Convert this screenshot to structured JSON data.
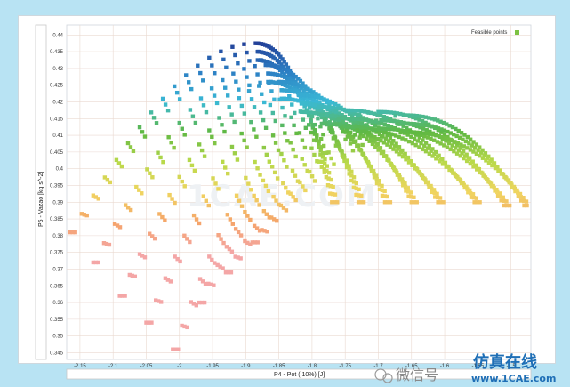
{
  "chart_data": {
    "type": "scatter",
    "title": "",
    "xlabel": "P4 - Pot (.10%) [J]",
    "ylabel": "P5 - Vazao  [kg s^-2]",
    "xlim": [
      -2.17,
      -1.47
    ],
    "ylim": [
      0.343,
      0.443
    ],
    "x_ticks": [
      "-2.15",
      "-2.1",
      "-2.05",
      "-2",
      "-1.95",
      "-1.9",
      "-1.85",
      "-1.8",
      "-1.75",
      "-1.7",
      "-1.65",
      "-1.6",
      "-1.55",
      "-1.5"
    ],
    "y_ticks": [
      "0.44",
      "0.435",
      "0.43",
      "0.425",
      "0.42",
      "0.415",
      "0.41",
      "0.405",
      "0.4",
      "0.395",
      "0.39",
      "0.385",
      "0.38",
      "0.375",
      "0.37",
      "0.365",
      "0.36",
      "0.355",
      "0.35",
      "0.345"
    ],
    "grid": true,
    "legend": {
      "position": "top-right",
      "entries": [
        {
          "name": "Feasible points",
          "color": "#7dc242"
        }
      ]
    },
    "color_scale": [
      "#f4a6a6",
      "#f5a46a",
      "#f0d560",
      "#b9d94a",
      "#5fb843",
      "#3ab9d6",
      "#2c7fc4",
      "#223d96"
    ],
    "curve_groups": [
      {
        "x_start": -2.165,
        "y_start": 0.381,
        "x_peak": -1.885,
        "y_peak": 0.4375,
        "x_end": -1.77,
        "y_end": 0.39
      },
      {
        "x_start": -2.13,
        "y_start": 0.372,
        "x_peak": -1.87,
        "y_peak": 0.431,
        "x_end": -1.73,
        "y_end": 0.39
      },
      {
        "x_start": -2.09,
        "y_start": 0.362,
        "x_peak": -1.85,
        "y_peak": 0.426,
        "x_end": -1.69,
        "y_end": 0.39
      },
      {
        "x_start": -2.05,
        "y_start": 0.354,
        "x_peak": -1.82,
        "y_peak": 0.422,
        "x_end": -1.65,
        "y_end": 0.39
      },
      {
        "x_start": -2.01,
        "y_start": 0.346,
        "x_peak": -1.79,
        "y_peak": 0.4185,
        "x_end": -1.61,
        "y_end": 0.39
      },
      {
        "x_start": -1.97,
        "y_start": 0.36,
        "x_peak": -1.75,
        "y_peak": 0.4175,
        "x_end": -1.555,
        "y_end": 0.39
      },
      {
        "x_start": -1.93,
        "y_start": 0.369,
        "x_peak": -1.7,
        "y_peak": 0.417,
        "x_end": -1.51,
        "y_end": 0.389
      },
      {
        "x_start": -1.89,
        "y_start": 0.378,
        "x_peak": -1.66,
        "y_peak": 0.416,
        "x_end": -1.48,
        "y_end": 0.389
      }
    ]
  },
  "watermark": {
    "center": "1CAE.COM",
    "bottom_left": "微信号",
    "bottom_brand_cn": "仿真在线",
    "bottom_brand_url": "www.1CAE.com"
  }
}
